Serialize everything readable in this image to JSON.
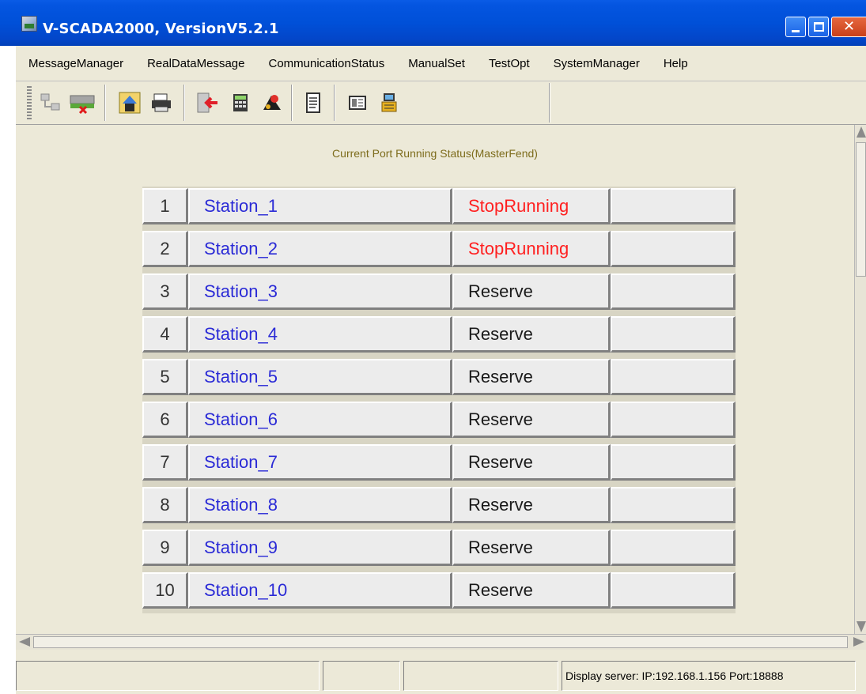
{
  "window": {
    "title": "V-SCADA2000, VersionV5.2.1"
  },
  "menubar": {
    "items": [
      {
        "label": "MessageManager"
      },
      {
        "label": "RealDataMessage"
      },
      {
        "label": "CommunicationStatus"
      },
      {
        "label": "ManualSet"
      },
      {
        "label": "TestOpt"
      },
      {
        "label": "SystemManager"
      },
      {
        "label": "Help"
      }
    ]
  },
  "toolbar": {
    "icons": [
      "network-disconnect-icon",
      "monitor-remove-icon",
      "home-icon",
      "print-icon",
      "exit-icon",
      "calculator-icon",
      "alarm-icon",
      "document-icon",
      "panel-icon",
      "user-icon"
    ]
  },
  "panel": {
    "title": "Current Port Running Status(MasterFend)"
  },
  "ports": [
    {
      "num": "1",
      "name": "Station_1",
      "status": "StopRunning",
      "extra": ""
    },
    {
      "num": "2",
      "name": "Station_2",
      "status": "StopRunning",
      "extra": ""
    },
    {
      "num": "3",
      "name": "Station_3",
      "status": "Reserve",
      "extra": ""
    },
    {
      "num": "4",
      "name": "Station_4",
      "status": "Reserve",
      "extra": ""
    },
    {
      "num": "5",
      "name": "Station_5",
      "status": "Reserve",
      "extra": ""
    },
    {
      "num": "6",
      "name": "Station_6",
      "status": "Reserve",
      "extra": ""
    },
    {
      "num": "7",
      "name": "Station_7",
      "status": "Reserve",
      "extra": ""
    },
    {
      "num": "8",
      "name": "Station_8",
      "status": "Reserve",
      "extra": ""
    },
    {
      "num": "9",
      "name": "Station_9",
      "status": "Reserve",
      "extra": ""
    },
    {
      "num": "10",
      "name": "Station_10",
      "status": "Reserve",
      "extra": ""
    }
  ],
  "statusbar": {
    "pane1": "",
    "pane2": "",
    "pane3": "",
    "server": "Display server: IP:192.168.1.156 Port:18888"
  },
  "colors": {
    "titlebar": "#0050d8",
    "status_stop": "#ff2020",
    "station_name": "#2a2ad6",
    "panel_title": "#7d6c1c"
  }
}
